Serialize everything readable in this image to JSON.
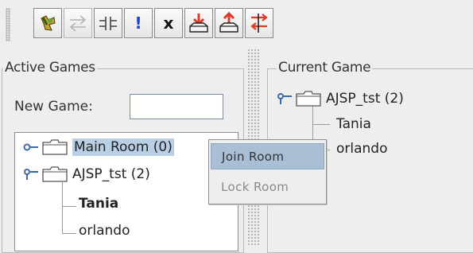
{
  "toolbar": {
    "buttons": [
      {
        "name": "connect",
        "icon": "tool-connect-icon"
      },
      {
        "name": "arrows",
        "icon": "arrows-swap-icon"
      },
      {
        "name": "split",
        "icon": "split-icon"
      },
      {
        "name": "alert",
        "icon": "exclamation-icon",
        "glyph": "!"
      },
      {
        "name": "close",
        "icon": "x-icon",
        "glyph": "x"
      },
      {
        "name": "download",
        "icon": "download-tray-icon"
      },
      {
        "name": "upload",
        "icon": "upload-tray-icon"
      },
      {
        "name": "transfer",
        "icon": "transfer-icon"
      }
    ]
  },
  "left_panel": {
    "title": "Active Games",
    "new_game_label": "New Game:",
    "new_game_value": "",
    "tree": {
      "root": "Main Room (0)",
      "game": "AJSP_tst (2)",
      "players": [
        "Tania",
        "orlando"
      ]
    }
  },
  "right_panel": {
    "title": "Current Game",
    "tree": {
      "game": "AJSP_tst (2)",
      "players": [
        "Tania",
        "orlando"
      ]
    }
  },
  "context_menu": {
    "items": [
      {
        "label": "Join Room",
        "state": "highlighted"
      },
      {
        "label": "Lock Room",
        "state": "disabled"
      }
    ]
  },
  "colors": {
    "selection": "#b9cfe6",
    "menu_highlight": "#a9bfd6",
    "icon_red": "#e23a2a",
    "icon_blue": "#1a3fd0"
  }
}
